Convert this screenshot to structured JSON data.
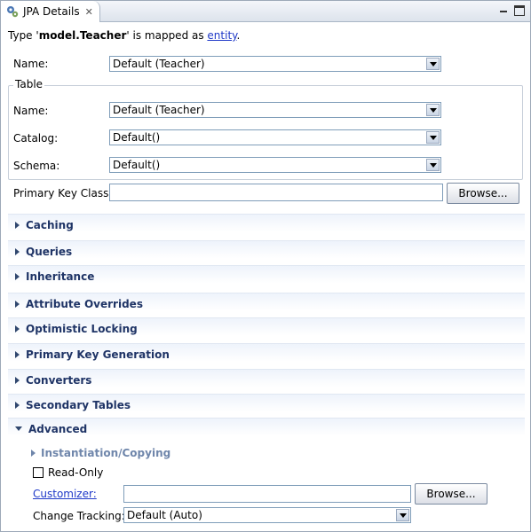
{
  "tab": {
    "title": "JPA Details",
    "close_glyph": "✕"
  },
  "header": {
    "prefix": "Type '",
    "type_name": "model.Teacher",
    "middle": "' is mapped as ",
    "mapping_link": "entity",
    "suffix": "."
  },
  "entity": {
    "name_label": "Name:",
    "name_value": "Default (Teacher)"
  },
  "table": {
    "legend": "Table",
    "name_label": "Name:",
    "name_value": "Default (Teacher)",
    "catalog_label": "Catalog:",
    "catalog_value": "Default()",
    "schema_label": "Schema:",
    "schema_value": "Default()"
  },
  "primary_key": {
    "label": "Primary Key Class:",
    "value": "",
    "browse_label": "Browse..."
  },
  "sections": {
    "caching": "Caching",
    "queries": "Queries",
    "inheritance": "Inheritance",
    "attribute_overrides": "Attribute Overrides",
    "optimistic_locking": "Optimistic Locking",
    "primary_key_generation": "Primary Key Generation",
    "converters": "Converters",
    "secondary_tables": "Secondary Tables",
    "advanced": "Advanced"
  },
  "advanced": {
    "instantiation_label": "Instantiation/Copying",
    "read_only_label": "Read-Only",
    "read_only_checked": false,
    "customizer_label": "Customizer:",
    "customizer_value": "",
    "customizer_browse": "Browse...",
    "change_tracking_label": "Change Tracking:",
    "change_tracking_value": "Default (Auto)"
  },
  "colors": {
    "section_title": "#1f3466",
    "link": "#1f39c8",
    "subsection_title": "#6f86ab"
  }
}
